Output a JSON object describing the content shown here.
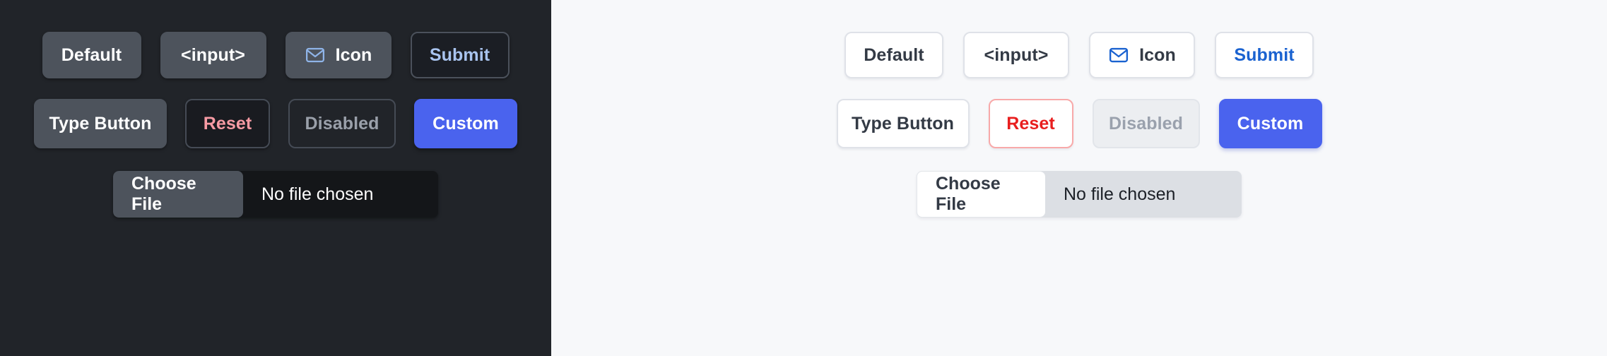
{
  "panels": {
    "dark": {
      "theme_name": "dark",
      "background_color": "#212429",
      "row1": [
        {
          "label": "Default",
          "kind": "plain"
        },
        {
          "label": "<input>",
          "kind": "plain"
        },
        {
          "label": "Icon",
          "kind": "icon",
          "icon": "envelope-icon",
          "icon_color": "#8fb4e8"
        },
        {
          "label": "Submit",
          "kind": "submit",
          "text_color": "#a9c4ef"
        }
      ],
      "row2": [
        {
          "label": "Type Button",
          "kind": "plain"
        },
        {
          "label": "Reset",
          "kind": "reset",
          "text_color": "#f79ba4"
        },
        {
          "label": "Disabled",
          "kind": "disabled",
          "text_color": "#9aa0aa"
        },
        {
          "label": "Custom",
          "kind": "custom",
          "accent_color": "#4a63ee"
        }
      ],
      "file": {
        "button_label": "Choose File",
        "status_label": "No file chosen"
      }
    },
    "light": {
      "theme_name": "light",
      "background_color": "#f7f8fa",
      "row1": [
        {
          "label": "Default",
          "kind": "plain"
        },
        {
          "label": "<input>",
          "kind": "plain"
        },
        {
          "label": "Icon",
          "kind": "icon",
          "icon": "envelope-icon",
          "icon_color": "#1a62d0"
        },
        {
          "label": "Submit",
          "kind": "submit",
          "text_color": "#1a62d0"
        }
      ],
      "row2": [
        {
          "label": "Type Button",
          "kind": "plain"
        },
        {
          "label": "Reset",
          "kind": "reset",
          "text_color": "#e81e1e",
          "border_color": "#f8a9a9"
        },
        {
          "label": "Disabled",
          "kind": "disabled",
          "text_color": "#9aa1ad"
        },
        {
          "label": "Custom",
          "kind": "custom",
          "accent_color": "#4a63ee"
        }
      ],
      "file": {
        "button_label": "Choose File",
        "status_label": "No file chosen"
      }
    }
  }
}
